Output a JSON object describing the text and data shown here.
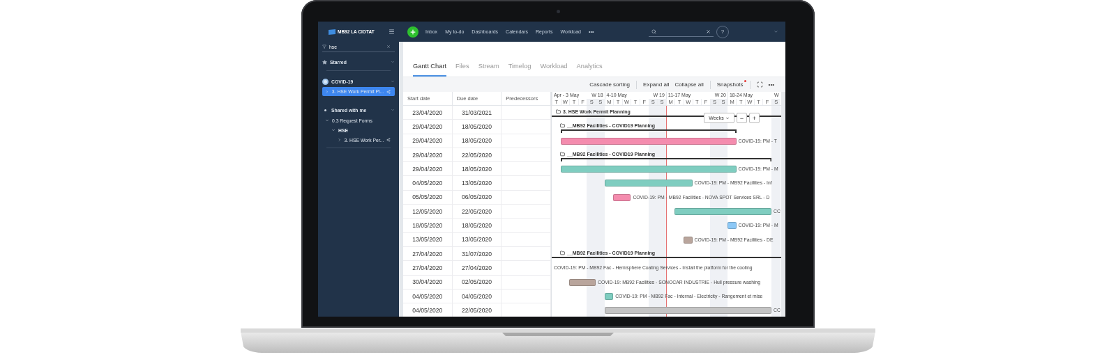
{
  "topbar": {
    "brand": "MB92 LA CIOTAT",
    "nav": [
      "Inbox",
      "My to-do",
      "Dashboards",
      "Calendars",
      "Reports",
      "Workload"
    ],
    "more": "•••",
    "help": "?"
  },
  "sidebar": {
    "filter": "hse",
    "starred": "Starred",
    "spaces": [
      {
        "label": "COVID-19",
        "items": [
          {
            "label": "3. HSE Work Permit Pl...",
            "selected": true,
            "expanded": false
          }
        ]
      }
    ],
    "shared": {
      "label": "Shared with me",
      "folders": [
        {
          "label": "0.3 Request Forms",
          "selected": false,
          "expanded": true,
          "children": [
            {
              "label": "HSE",
              "selected": false,
              "expanded": true,
              "children": [
                {
                  "label": "3. HSE Work Per...",
                  "selected": false,
                  "expanded": false
                }
              ]
            }
          ]
        }
      ]
    }
  },
  "tabs": [
    {
      "label": "Gantt Chart",
      "selected": true
    },
    {
      "label": "Files",
      "selected": false
    },
    {
      "label": "Stream",
      "selected": false
    },
    {
      "label": "Timelog",
      "selected": false
    },
    {
      "label": "Workload",
      "selected": false
    },
    {
      "label": "Analytics",
      "selected": false
    }
  ],
  "toolbar": {
    "cascade": "Cascade sorting",
    "expand": "Expand all",
    "collapse": "Collapse all",
    "snapshots": "Snapshots",
    "snapshots_new": true,
    "more": "•••"
  },
  "table": {
    "columns": [
      "Start date",
      "Due date",
      "Predecessors"
    ]
  },
  "gantt": {
    "weeks": [
      {
        "range": "Apr - 3 May",
        "week": "W 18"
      },
      {
        "range": "4-10 May",
        "week": "W 19"
      },
      {
        "range": "11-17 May",
        "week": "W 20"
      },
      {
        "range": "18-24 May",
        "week": "W"
      }
    ],
    "days": [
      "T",
      "W",
      "T",
      "F",
      "S",
      "S",
      "M",
      "T",
      "W",
      "T",
      "F",
      "S",
      "S",
      "M",
      "T",
      "W",
      "T",
      "F",
      "S",
      "S",
      "M",
      "T",
      "W",
      "T",
      "F",
      "S"
    ],
    "zoom": {
      "scale": "Weeks",
      "out": "−",
      "in": "+"
    },
    "rows": [
      {
        "kind": "project",
        "start": "23/04/2020",
        "due": "31/03/2021",
        "label": "3. HSE Work Permit Planning"
      },
      {
        "kind": "group",
        "start": "29/04/2020",
        "due": "18/05/2020",
        "label": "__MB92 Facilities - COVID19 Planning"
      },
      {
        "kind": "task",
        "start": "29/04/2020",
        "due": "18/05/2020",
        "label": "COVID-19: PM - T",
        "color": "#f48cae"
      },
      {
        "kind": "group",
        "start": "29/04/2020",
        "due": "22/05/2020",
        "label": "__MB92 Facilities - COVID19 Planning"
      },
      {
        "kind": "task",
        "start": "29/04/2020",
        "due": "18/05/2020",
        "label": "COVID-19: PM - M",
        "color": "#7fcdc0"
      },
      {
        "kind": "task",
        "start": "04/05/2020",
        "due": "13/05/2020",
        "label": "COVID-19: PM - MB92 Facilities - Inf",
        "color": "#7fcdc0"
      },
      {
        "kind": "task",
        "start": "05/05/2020",
        "due": "06/05/2020",
        "label": "COVID-19: PM - MB92 Facilities - NOVA SPOT Services SRL - D",
        "color": "#f48cae"
      },
      {
        "kind": "task",
        "start": "12/05/2020",
        "due": "22/05/2020",
        "label": "CC",
        "color": "#7fcdc0"
      },
      {
        "kind": "task",
        "start": "18/05/2020",
        "due": "18/05/2020",
        "label": "COVID-19: PM - M",
        "color": "#8cc8f6"
      },
      {
        "kind": "task",
        "start": "13/05/2020",
        "due": "13/05/2020",
        "label": "COVID-19: PM - MB92 Facilities - DE",
        "color": "#b9a59c"
      },
      {
        "kind": "summary",
        "start": "27/04/2020",
        "due": "31/07/2020",
        "label": "__MB92 Facilities - COVID19 Planning"
      },
      {
        "kind": "task",
        "start": "27/04/2020",
        "due": "27/04/2020",
        "label": "COVID-19: PM - MB92 Fac - Hemisphere Coating Services - Install the platform for the cooling"
      },
      {
        "kind": "task",
        "start": "30/04/2020",
        "due": "02/05/2020",
        "label": "COVID-19: MB92 Facilities - SONOCAR INDUSTRIE - Hull pressure washing",
        "color": "#b9a59c"
      },
      {
        "kind": "task",
        "start": "04/05/2020",
        "due": "04/05/2020",
        "label": "COVID-19: PM - MB92 Fac - Internal - Electricity - Rangement et mise",
        "color": "#7fcdc0"
      },
      {
        "kind": "task",
        "start": "04/05/2020",
        "due": "22/05/2020",
        "label": "CC",
        "color": "#c4c4c4"
      }
    ]
  }
}
